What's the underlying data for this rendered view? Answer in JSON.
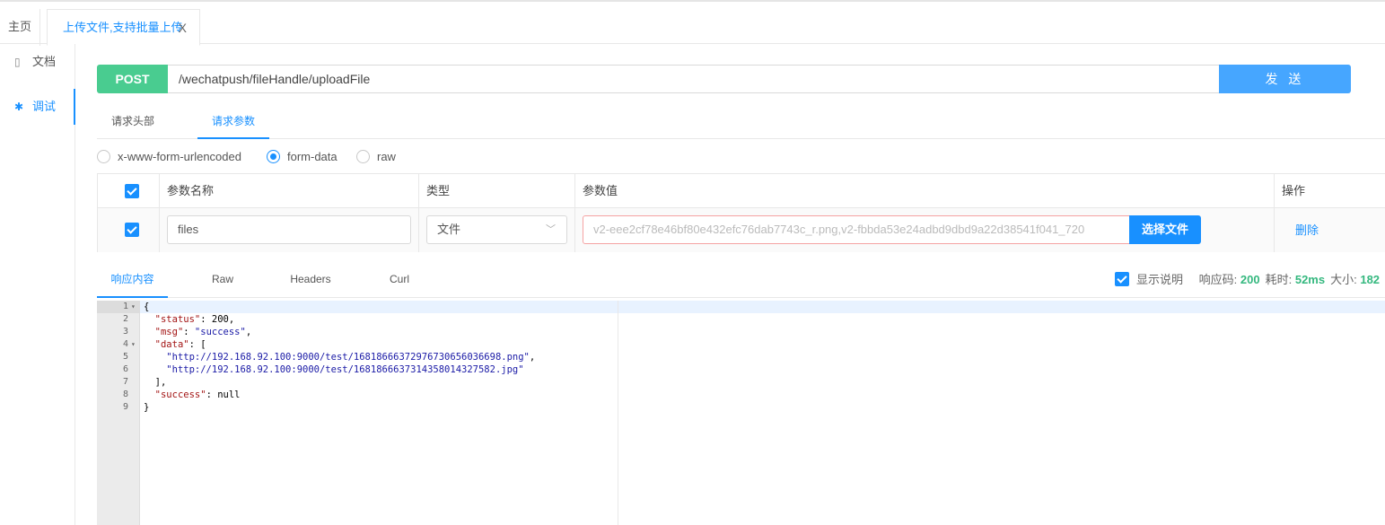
{
  "top_tabs": {
    "home": "主页",
    "active": "上传文件,支持批量上传",
    "close": "X"
  },
  "sidebar": {
    "items": [
      {
        "label": "文档",
        "icon": "document-icon"
      },
      {
        "label": "调试",
        "icon": "bug-icon"
      }
    ]
  },
  "request": {
    "method": "POST",
    "url": "/wechatpush/fileHandle/uploadFile",
    "send_label": "发 送",
    "method_color": "#49cc90",
    "send_color": "#46a6ff"
  },
  "request_tabs": [
    "请求头部",
    "请求参数"
  ],
  "body_types": {
    "options": [
      "x-www-form-urlencoded",
      "form-data",
      "raw"
    ],
    "selected": "form-data"
  },
  "params_table": {
    "headers": [
      "参数名称",
      "类型",
      "参数值",
      "操作"
    ],
    "rows": [
      {
        "checked": true,
        "name": "files",
        "type": "文件",
        "value": "v2-eee2cf78e46bf80e432efc76dab7743c_r.png,v2-fbbda53e24adbd9dbd9a22d38541f041_720",
        "choose_label": "选择文件",
        "action_label": "删除"
      }
    ]
  },
  "response_tabs": [
    "响应内容",
    "Raw",
    "Headers",
    "Curl"
  ],
  "response_meta": {
    "show_desc_label": "显示说明",
    "code_label": "响应码:",
    "code": "200",
    "time_label": "耗时:",
    "time": "52ms",
    "size_label": "大小:",
    "size": "182"
  },
  "response_code": {
    "lines": [
      {
        "n": "1",
        "fold": "▾",
        "text": "{"
      },
      {
        "n": "2",
        "fold": "",
        "key": "\"status\"",
        "rest": ": 200,"
      },
      {
        "n": "3",
        "fold": "",
        "key": "\"msg\"",
        "sep": ": ",
        "str": "\"success\"",
        "tail": ","
      },
      {
        "n": "4",
        "fold": "▾",
        "key": "\"data\"",
        "rest": ": ["
      },
      {
        "n": "5",
        "fold": "",
        "str": "\"http://192.168.92.100:9000/test/16818666372976730656036698.png\"",
        "tail": ","
      },
      {
        "n": "6",
        "fold": "",
        "str": "\"http://192.168.92.100:9000/test/1681866637314358014327582.jpg\"",
        "tail": ""
      },
      {
        "n": "7",
        "fold": "",
        "text": "  ],"
      },
      {
        "n": "8",
        "fold": "",
        "key": "\"success\"",
        "rest": ": null"
      },
      {
        "n": "9",
        "fold": "",
        "text": "}"
      }
    ]
  }
}
